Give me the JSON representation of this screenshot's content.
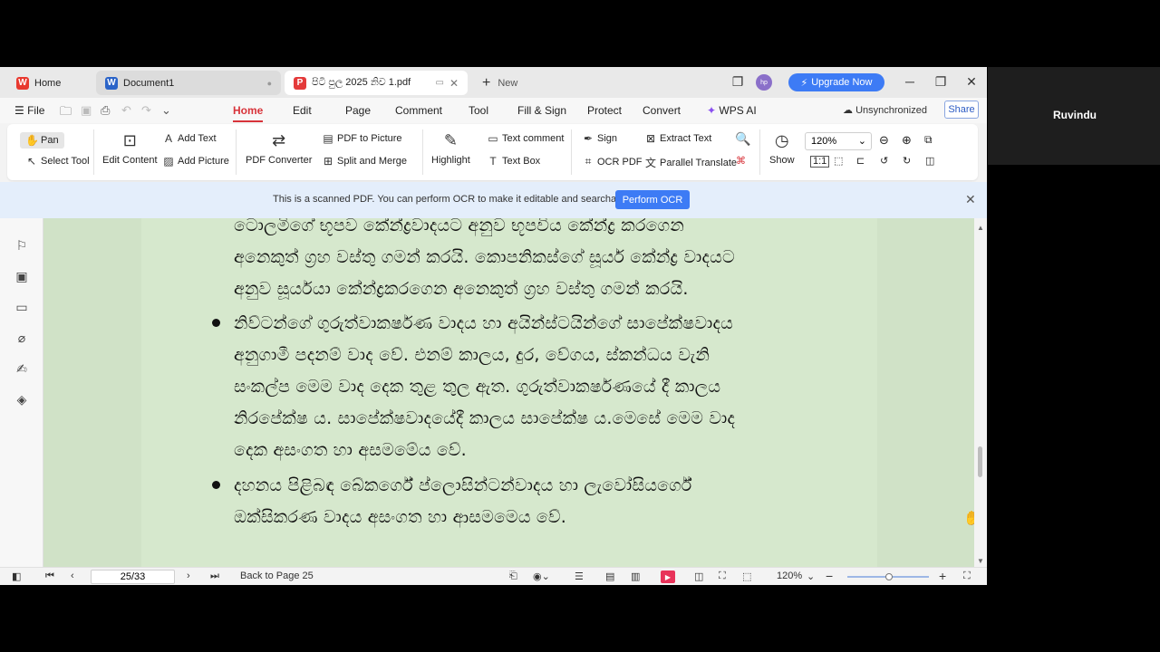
{
  "side_panel": {
    "user_name": "Ruvindu"
  },
  "tabs": [
    {
      "label": "Home",
      "icon": "wps-logo-icon",
      "color": "#e8392f"
    },
    {
      "label": "Document1",
      "icon": "word-doc-icon",
      "color": "#2b64c8"
    },
    {
      "label": "පිටි පුල 2025 නිව 1.pdf",
      "icon": "pdf-doc-icon",
      "color": "#e43a3a"
    },
    {
      "label": "New",
      "icon": "plus-icon"
    }
  ],
  "window": {
    "upgrade_label": "Upgrade Now",
    "avatar_initials": "hp"
  },
  "menu": {
    "file_label": "File",
    "items": [
      "Home",
      "Edit",
      "Page",
      "Comment",
      "Tool",
      "Fill & Sign",
      "Protect",
      "Convert",
      "WPS AI"
    ],
    "unsync_label": "Unsynchronized",
    "share_label": "Share"
  },
  "ribbon": {
    "pan": "Pan",
    "select_tool": "Select Tool",
    "edit_content": "Edit Content",
    "add_text": "Add Text",
    "add_picture": "Add Picture",
    "pdf_converter": "PDF Converter",
    "pdf_to_picture": "PDF to Picture",
    "split_merge": "Split and Merge",
    "highlight": "Highlight",
    "text_comment": "Text comment",
    "text_box": "Text Box",
    "sign": "Sign",
    "ocr_pdf": "OCR PDF",
    "extract_text": "Extract Text",
    "parallel_translate": "Parallel Translate",
    "show": "Show",
    "zoom_value": "120%"
  },
  "ocr_bar": {
    "message": "This is a scanned PDF. You can perform OCR to make it editable and searchable.",
    "button": "Perform OCR"
  },
  "document": {
    "lines": [
      "ටොලමිගේ භූපව කේන්ද්‍රවාදයට අනුව  භූපවිය කේන්ද්‍ර කරගෙන",
      "අනෙකුත් ග්‍රහ වස්තු ගමන් කරයි. කොපනිකස්ගේ සූර්ය කේන්ද්‍ර වාදයට",
      "අනුව සූර්යයා කේන්ද්‍රකරගෙන අනෙකුත් ග්‍රහ වස්තු ගමන් කරයි.",
      "නිව්ටන්ගේ ගුරුත්වාකර්ෂණ වාදය හා  අයින්ස්ටයින්ගේ සාපේක්ෂවාදය",
      "අනුගාමී පදනම් වාද වේ. එනම් කාලය, දුර, වේගය, ස්කන්ධය වැනි",
      "සංකල්ප මෙම වාද දෙක තුළ තුල ඇත. ගුරුත්වාකර්ෂණයේ දී කාලය",
      "නිරපේක්ෂ ය. සාපේක්ෂවාදයේදී කාලය සාපේක්ෂ ය.මෙසේ මෙම වාද",
      "දෙක අසංගත හා අසමමේය වේ.",
      "දහනය පිළිබඳ බේකර්ගේ ප්ලොසින්ටන්වාදය හා ලැවෝසියර්ගේ",
      "ඔක්සිකරණ වාදය අසංගත හා ආසමමෙය වේ."
    ]
  },
  "status": {
    "page": "25/33",
    "back_to_page": "Back to Page 25",
    "zoom": "120%"
  }
}
